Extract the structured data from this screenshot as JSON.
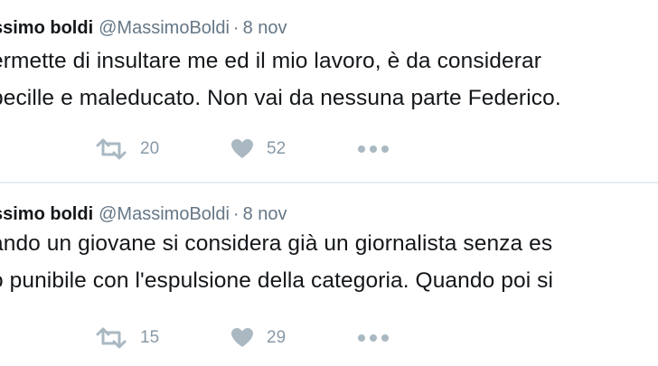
{
  "tweets": [
    {
      "author_name": "ssimo boldi",
      "handle": "@MassimoBoldi",
      "separator": "·",
      "date": "8 nov",
      "text_lines": [
        "ermette di insultare me ed il mio lavoro, è da considerar",
        "becille e maleducato. Non vai da nessuna parte Federico."
      ],
      "retweets": "20",
      "likes": "52"
    },
    {
      "author_name": "ssimo boldi",
      "handle": "@MassimoBoldi",
      "separator": "·",
      "date": "8 nov",
      "text_lines": [
        "ando un giovane si considera già un giornalista senza es",
        "o punibile con l'espulsione della categoria. Quando poi si"
      ],
      "retweets": "15",
      "likes": "29"
    }
  ],
  "icons": {
    "retweet": "retweet-icon",
    "like": "heart-icon",
    "more": "more-icon"
  },
  "colors": {
    "text": "#14171a",
    "secondary": "#657786",
    "icon": "#aab8c2",
    "divider": "#e6ecf0"
  }
}
